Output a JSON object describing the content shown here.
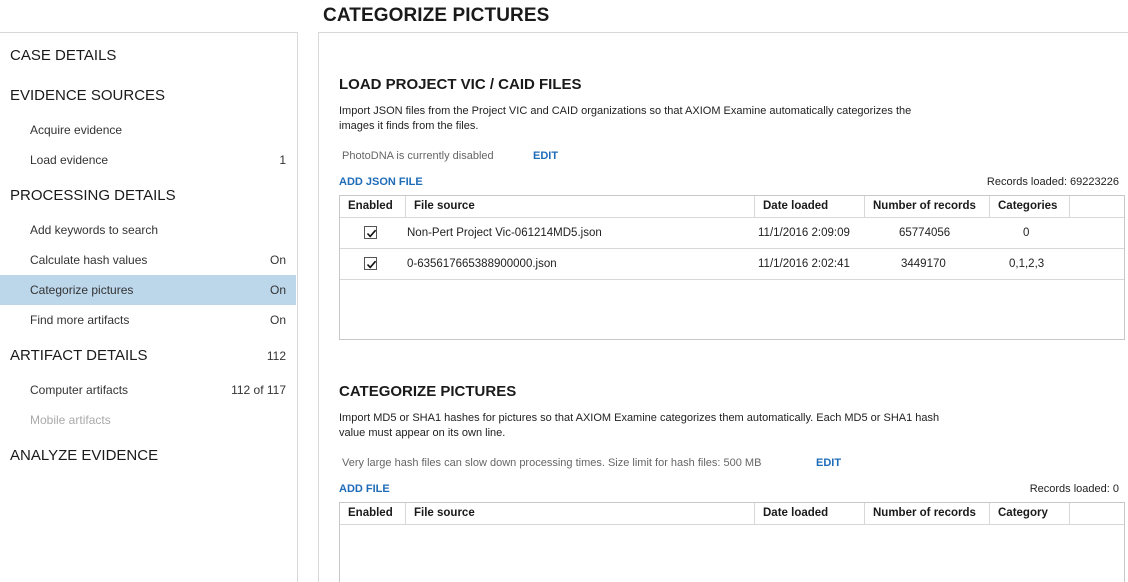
{
  "page": {
    "title": "CATEGORIZE PICTURES"
  },
  "sidebar": {
    "case_details": "CASE DETAILS",
    "evidence_sources": "EVIDENCE SOURCES",
    "acquire_evidence": "Acquire evidence",
    "load_evidence": {
      "label": "Load evidence",
      "value": "1"
    },
    "processing_details": "PROCESSING DETAILS",
    "add_keywords": "Add keywords to search",
    "calculate_hash": {
      "label": "Calculate hash values",
      "value": "On"
    },
    "categorize_pictures": {
      "label": "Categorize pictures",
      "value": "On"
    },
    "find_more": {
      "label": "Find more artifacts",
      "value": "On"
    },
    "artifact_details": {
      "label": "ARTIFACT DETAILS",
      "value": "112"
    },
    "computer_artifacts": {
      "label": "Computer artifacts",
      "value": "112 of 117"
    },
    "mobile_artifacts": "Mobile artifacts",
    "analyze_evidence": "ANALYZE EVIDENCE"
  },
  "vic": {
    "title": "LOAD PROJECT VIC / CAID FILES",
    "description": "Import JSON files from the Project VIC and CAID organizations so that AXIOM Examine automatically categorizes the images it finds from the files.",
    "photodna_note": "PhotoDNA is currently disabled",
    "edit_label": "EDIT",
    "add_label": "ADD JSON FILE",
    "records_loaded": "Records loaded: 69223226",
    "columns": [
      "Enabled",
      "File source",
      "Date loaded",
      "Number of records",
      "Categories"
    ],
    "rows": [
      {
        "enabled": true,
        "file_source": "Non-Pert Project Vic-061214MD5.json",
        "date_loaded": "11/1/2016 2:09:09",
        "records": "65774056",
        "categories": "0"
      },
      {
        "enabled": true,
        "file_source": "0-635617665388900000.json",
        "date_loaded": "11/1/2016 2:02:41",
        "records": "3449170",
        "categories": "0,1,2,3"
      }
    ]
  },
  "hashes": {
    "title": "CATEGORIZE PICTURES",
    "description": "Import MD5 or SHA1 hashes for pictures so that AXIOM Examine categorizes them automatically. Each MD5 or SHA1 hash value must appear on its own line.",
    "size_note": "Very large hash files can slow down processing times. Size limit for hash files: 500 MB",
    "edit_label": "EDIT",
    "add_label": "ADD FILE",
    "records_loaded": "Records loaded: 0",
    "columns": [
      "Enabled",
      "File source",
      "Date loaded",
      "Number of records",
      "Category"
    ]
  }
}
